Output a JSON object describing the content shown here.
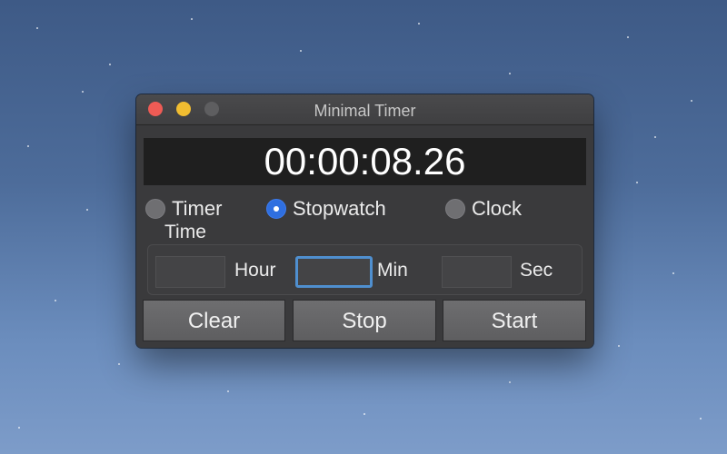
{
  "window": {
    "title": "Minimal Timer"
  },
  "display": {
    "time": "00:00:08.26"
  },
  "modes": {
    "timer_label": "Timer",
    "stopwatch_label": "Stopwatch",
    "clock_label": "Clock",
    "selected": "Stopwatch"
  },
  "time_input": {
    "section_label": "Time",
    "hour_label": "Hour",
    "min_label": "Min",
    "sec_label": "Sec",
    "hour_value": "",
    "min_value": "",
    "sec_value": ""
  },
  "buttons": {
    "clear_label": "Clear",
    "stop_label": "Stop",
    "start_label": "Start"
  },
  "colors": {
    "close": "#ee5b55",
    "minimize": "#f1bd31",
    "zoom_disabled": "#5e5e60",
    "radio_selected": "#2f6fe0",
    "focus_ring": "#4f8fcf"
  },
  "icons": {
    "close": "close-dot-icon",
    "minimize": "minimize-dot-icon",
    "zoom": "zoom-dot-icon"
  }
}
